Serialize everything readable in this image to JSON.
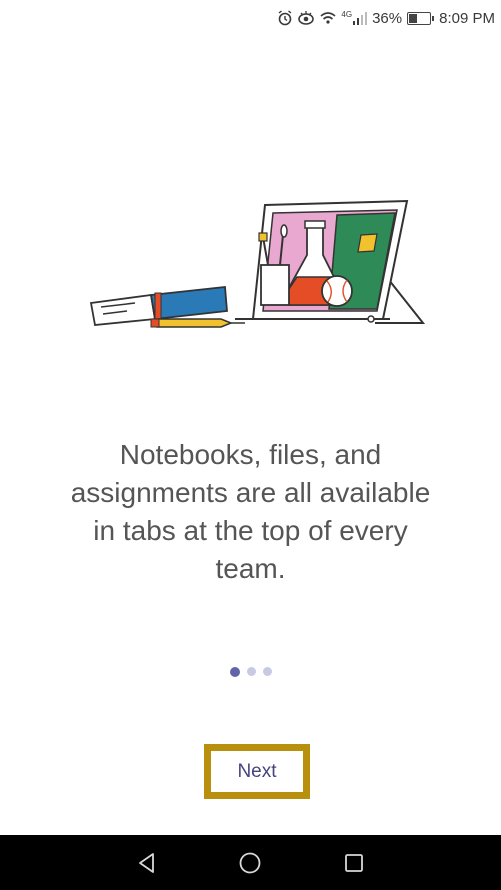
{
  "status_bar": {
    "icons": [
      "alarm-icon",
      "eye-icon",
      "wifi-icon",
      "signal-icon",
      "battery-icon"
    ],
    "network_label": "4G",
    "battery_percent": "36%",
    "time": "8:09 PM"
  },
  "onboarding": {
    "illustration": "school-supplies-illustration",
    "message": "Notebooks, files, and assignments are all available in tabs at the top of every team.",
    "page_index": 0,
    "page_count": 3
  },
  "actions": {
    "next_label": "Next"
  },
  "navigation": {
    "buttons": [
      "back-icon",
      "home-icon",
      "recents-icon"
    ]
  },
  "colors": {
    "accent": "#6264a7",
    "dot_inactive": "#c8c9e3",
    "highlight_border": "#b8900d",
    "text": "#555555"
  }
}
